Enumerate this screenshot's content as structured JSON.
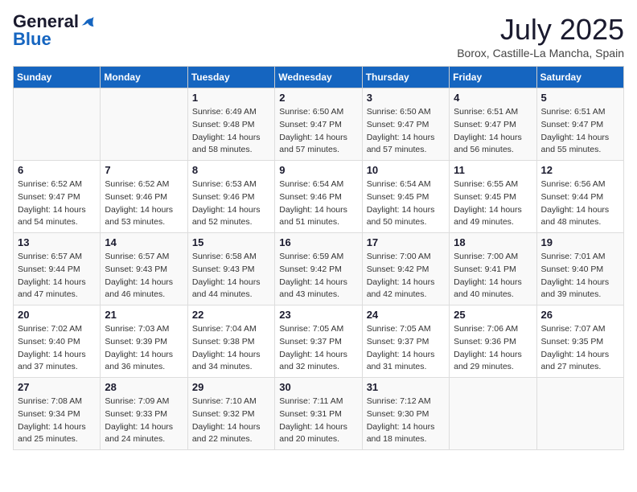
{
  "header": {
    "logo_general": "General",
    "logo_blue": "Blue",
    "month_title": "July 2025",
    "location": "Borox, Castille-La Mancha, Spain"
  },
  "weekdays": [
    "Sunday",
    "Monday",
    "Tuesday",
    "Wednesday",
    "Thursday",
    "Friday",
    "Saturday"
  ],
  "weeks": [
    [
      {
        "day": "",
        "sunrise": "",
        "sunset": "",
        "daylight": ""
      },
      {
        "day": "",
        "sunrise": "",
        "sunset": "",
        "daylight": ""
      },
      {
        "day": "1",
        "sunrise": "Sunrise: 6:49 AM",
        "sunset": "Sunset: 9:48 PM",
        "daylight": "Daylight: 14 hours and 58 minutes."
      },
      {
        "day": "2",
        "sunrise": "Sunrise: 6:50 AM",
        "sunset": "Sunset: 9:47 PM",
        "daylight": "Daylight: 14 hours and 57 minutes."
      },
      {
        "day": "3",
        "sunrise": "Sunrise: 6:50 AM",
        "sunset": "Sunset: 9:47 PM",
        "daylight": "Daylight: 14 hours and 57 minutes."
      },
      {
        "day": "4",
        "sunrise": "Sunrise: 6:51 AM",
        "sunset": "Sunset: 9:47 PM",
        "daylight": "Daylight: 14 hours and 56 minutes."
      },
      {
        "day": "5",
        "sunrise": "Sunrise: 6:51 AM",
        "sunset": "Sunset: 9:47 PM",
        "daylight": "Daylight: 14 hours and 55 minutes."
      }
    ],
    [
      {
        "day": "6",
        "sunrise": "Sunrise: 6:52 AM",
        "sunset": "Sunset: 9:47 PM",
        "daylight": "Daylight: 14 hours and 54 minutes."
      },
      {
        "day": "7",
        "sunrise": "Sunrise: 6:52 AM",
        "sunset": "Sunset: 9:46 PM",
        "daylight": "Daylight: 14 hours and 53 minutes."
      },
      {
        "day": "8",
        "sunrise": "Sunrise: 6:53 AM",
        "sunset": "Sunset: 9:46 PM",
        "daylight": "Daylight: 14 hours and 52 minutes."
      },
      {
        "day": "9",
        "sunrise": "Sunrise: 6:54 AM",
        "sunset": "Sunset: 9:46 PM",
        "daylight": "Daylight: 14 hours and 51 minutes."
      },
      {
        "day": "10",
        "sunrise": "Sunrise: 6:54 AM",
        "sunset": "Sunset: 9:45 PM",
        "daylight": "Daylight: 14 hours and 50 minutes."
      },
      {
        "day": "11",
        "sunrise": "Sunrise: 6:55 AM",
        "sunset": "Sunset: 9:45 PM",
        "daylight": "Daylight: 14 hours and 49 minutes."
      },
      {
        "day": "12",
        "sunrise": "Sunrise: 6:56 AM",
        "sunset": "Sunset: 9:44 PM",
        "daylight": "Daylight: 14 hours and 48 minutes."
      }
    ],
    [
      {
        "day": "13",
        "sunrise": "Sunrise: 6:57 AM",
        "sunset": "Sunset: 9:44 PM",
        "daylight": "Daylight: 14 hours and 47 minutes."
      },
      {
        "day": "14",
        "sunrise": "Sunrise: 6:57 AM",
        "sunset": "Sunset: 9:43 PM",
        "daylight": "Daylight: 14 hours and 46 minutes."
      },
      {
        "day": "15",
        "sunrise": "Sunrise: 6:58 AM",
        "sunset": "Sunset: 9:43 PM",
        "daylight": "Daylight: 14 hours and 44 minutes."
      },
      {
        "day": "16",
        "sunrise": "Sunrise: 6:59 AM",
        "sunset": "Sunset: 9:42 PM",
        "daylight": "Daylight: 14 hours and 43 minutes."
      },
      {
        "day": "17",
        "sunrise": "Sunrise: 7:00 AM",
        "sunset": "Sunset: 9:42 PM",
        "daylight": "Daylight: 14 hours and 42 minutes."
      },
      {
        "day": "18",
        "sunrise": "Sunrise: 7:00 AM",
        "sunset": "Sunset: 9:41 PM",
        "daylight": "Daylight: 14 hours and 40 minutes."
      },
      {
        "day": "19",
        "sunrise": "Sunrise: 7:01 AM",
        "sunset": "Sunset: 9:40 PM",
        "daylight": "Daylight: 14 hours and 39 minutes."
      }
    ],
    [
      {
        "day": "20",
        "sunrise": "Sunrise: 7:02 AM",
        "sunset": "Sunset: 9:40 PM",
        "daylight": "Daylight: 14 hours and 37 minutes."
      },
      {
        "day": "21",
        "sunrise": "Sunrise: 7:03 AM",
        "sunset": "Sunset: 9:39 PM",
        "daylight": "Daylight: 14 hours and 36 minutes."
      },
      {
        "day": "22",
        "sunrise": "Sunrise: 7:04 AM",
        "sunset": "Sunset: 9:38 PM",
        "daylight": "Daylight: 14 hours and 34 minutes."
      },
      {
        "day": "23",
        "sunrise": "Sunrise: 7:05 AM",
        "sunset": "Sunset: 9:37 PM",
        "daylight": "Daylight: 14 hours and 32 minutes."
      },
      {
        "day": "24",
        "sunrise": "Sunrise: 7:05 AM",
        "sunset": "Sunset: 9:37 PM",
        "daylight": "Daylight: 14 hours and 31 minutes."
      },
      {
        "day": "25",
        "sunrise": "Sunrise: 7:06 AM",
        "sunset": "Sunset: 9:36 PM",
        "daylight": "Daylight: 14 hours and 29 minutes."
      },
      {
        "day": "26",
        "sunrise": "Sunrise: 7:07 AM",
        "sunset": "Sunset: 9:35 PM",
        "daylight": "Daylight: 14 hours and 27 minutes."
      }
    ],
    [
      {
        "day": "27",
        "sunrise": "Sunrise: 7:08 AM",
        "sunset": "Sunset: 9:34 PM",
        "daylight": "Daylight: 14 hours and 25 minutes."
      },
      {
        "day": "28",
        "sunrise": "Sunrise: 7:09 AM",
        "sunset": "Sunset: 9:33 PM",
        "daylight": "Daylight: 14 hours and 24 minutes."
      },
      {
        "day": "29",
        "sunrise": "Sunrise: 7:10 AM",
        "sunset": "Sunset: 9:32 PM",
        "daylight": "Daylight: 14 hours and 22 minutes."
      },
      {
        "day": "30",
        "sunrise": "Sunrise: 7:11 AM",
        "sunset": "Sunset: 9:31 PM",
        "daylight": "Daylight: 14 hours and 20 minutes."
      },
      {
        "day": "31",
        "sunrise": "Sunrise: 7:12 AM",
        "sunset": "Sunset: 9:30 PM",
        "daylight": "Daylight: 14 hours and 18 minutes."
      },
      {
        "day": "",
        "sunrise": "",
        "sunset": "",
        "daylight": ""
      },
      {
        "day": "",
        "sunrise": "",
        "sunset": "",
        "daylight": ""
      }
    ]
  ]
}
